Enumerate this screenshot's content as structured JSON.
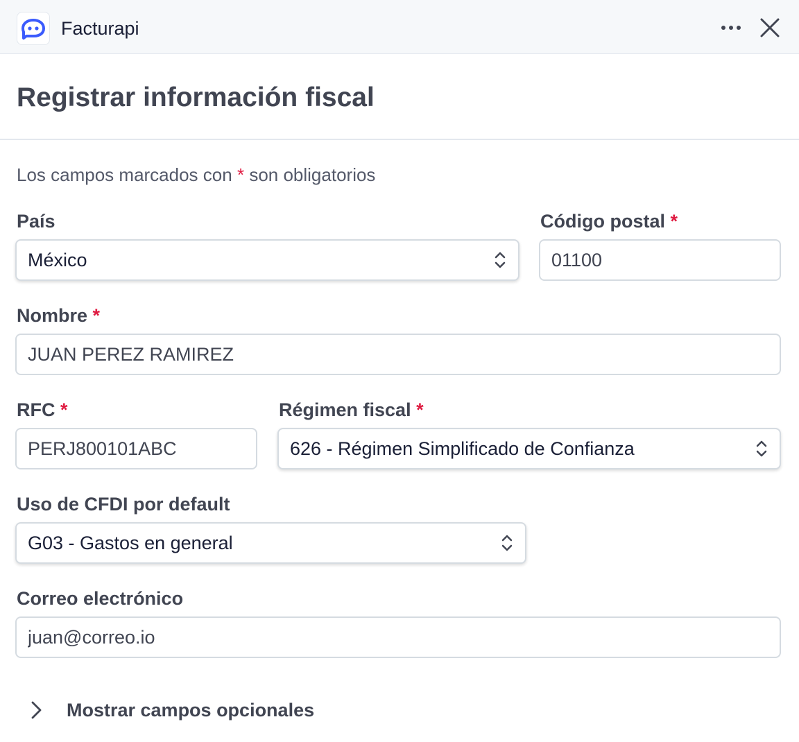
{
  "app": {
    "name": "Facturapi",
    "brand_color": "#3b5bfd",
    "accent_color": "#d9651e"
  },
  "header": {
    "title": "Registrar información fiscal"
  },
  "form": {
    "required_note_prefix": "Los campos marcados con",
    "required_marker": "*",
    "required_note_suffix": "son obligatorios",
    "country": {
      "label": "País",
      "value": "México"
    },
    "postal_code": {
      "label": "Código postal",
      "value": "01100"
    },
    "name": {
      "label": "Nombre",
      "value": "JUAN PEREZ RAMIREZ"
    },
    "rfc": {
      "label": "RFC",
      "value": "PERJ800101ABC"
    },
    "tax_regime": {
      "label": "Régimen fiscal",
      "value": "626 - Régimen Simplificado de Confianza"
    },
    "cfdi_use": {
      "label": "Uso de CFDI por default",
      "value": "G03 - Gastos en general"
    },
    "email": {
      "label": "Correo electrónico",
      "value": "juan@correo.io"
    },
    "optional_toggle_label": "Mostrar campos opcionales"
  },
  "icons": {
    "logo": "facturapi-logo-icon",
    "more": "more-options-icon",
    "close": "close-icon",
    "select_arrows": "chevron-up-down-icon",
    "expand": "chevron-right-icon"
  }
}
